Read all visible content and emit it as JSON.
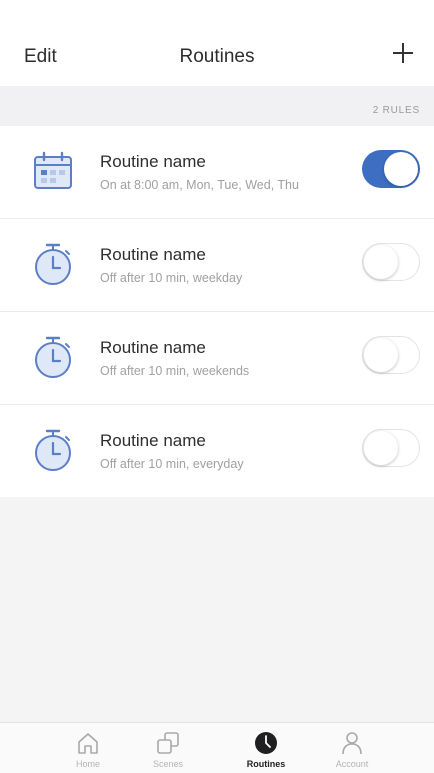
{
  "header": {
    "edit_label": "Edit",
    "title": "Routines",
    "add_icon": "plus-icon"
  },
  "section": {
    "count_label": "2 RULES"
  },
  "routines": [
    {
      "name": "Routine name",
      "detail": "On at 8:00 am, Mon, Tue, Wed, Thu",
      "icon": "calendar-icon",
      "enabled": true
    },
    {
      "name": "Routine name",
      "detail": "Off after 10 min, weekday",
      "icon": "timer-icon",
      "enabled": false
    },
    {
      "name": "Routine name",
      "detail": "Off after 10 min, weekends",
      "icon": "timer-icon",
      "enabled": false
    },
    {
      "name": "Routine name",
      "detail": "Off after 10 min, everyday",
      "icon": "timer-icon",
      "enabled": false
    }
  ],
  "tabbar": {
    "tabs": [
      {
        "label": "Home",
        "icon": "home-icon",
        "active": false
      },
      {
        "label": "Scenes",
        "icon": "scenes-icon",
        "active": false
      },
      {
        "label": "Routines",
        "icon": "routines-icon",
        "active": true
      },
      {
        "label": "Account",
        "icon": "account-icon",
        "active": false
      }
    ]
  },
  "colors": {
    "accent": "#3d6ec2",
    "icon_stroke": "#5b7fc6",
    "icon_fill": "#dfe8f7"
  }
}
